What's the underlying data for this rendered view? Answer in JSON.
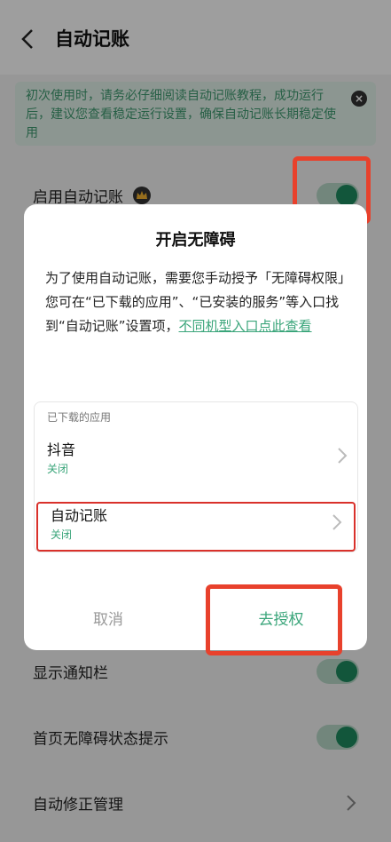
{
  "header": {
    "title": "自动记账"
  },
  "notice": {
    "text": "初次使用时，请务必仔细阅读自动记账教程，成功运行后，建议您查看稳定运行设置，确保自动记账长期稳定使用",
    "close_label": "×"
  },
  "settings": [
    {
      "label": "启用自动记账",
      "control": "toggle",
      "state": "on"
    },
    {
      "label": "显示通知栏",
      "control": "toggle",
      "state": "on"
    },
    {
      "label": "首页无障碍状态提示",
      "control": "toggle",
      "state": "on"
    },
    {
      "label": "自动修正管理",
      "control": "chevron"
    }
  ],
  "dialog": {
    "title": "开启无障碍",
    "body_line1": "为了使用自动记账，需要您手动授予「无障碍权限」",
    "body_line2": "您可在“已下载的应用”、“已安装的服务”等入口找到“自动记账”设置项，",
    "link": "不同机型入口点此查看",
    "list_header": "已下载的应用",
    "apps": [
      {
        "name": "抖音",
        "status": "关闭"
      },
      {
        "name": "自动记账",
        "status": "关闭"
      }
    ],
    "cancel_label": "取消",
    "confirm_label": "去授权"
  },
  "colors": {
    "accent": "#3aa57a",
    "toggle_knob": "#1e8c5f",
    "highlight": "#e8412c"
  }
}
